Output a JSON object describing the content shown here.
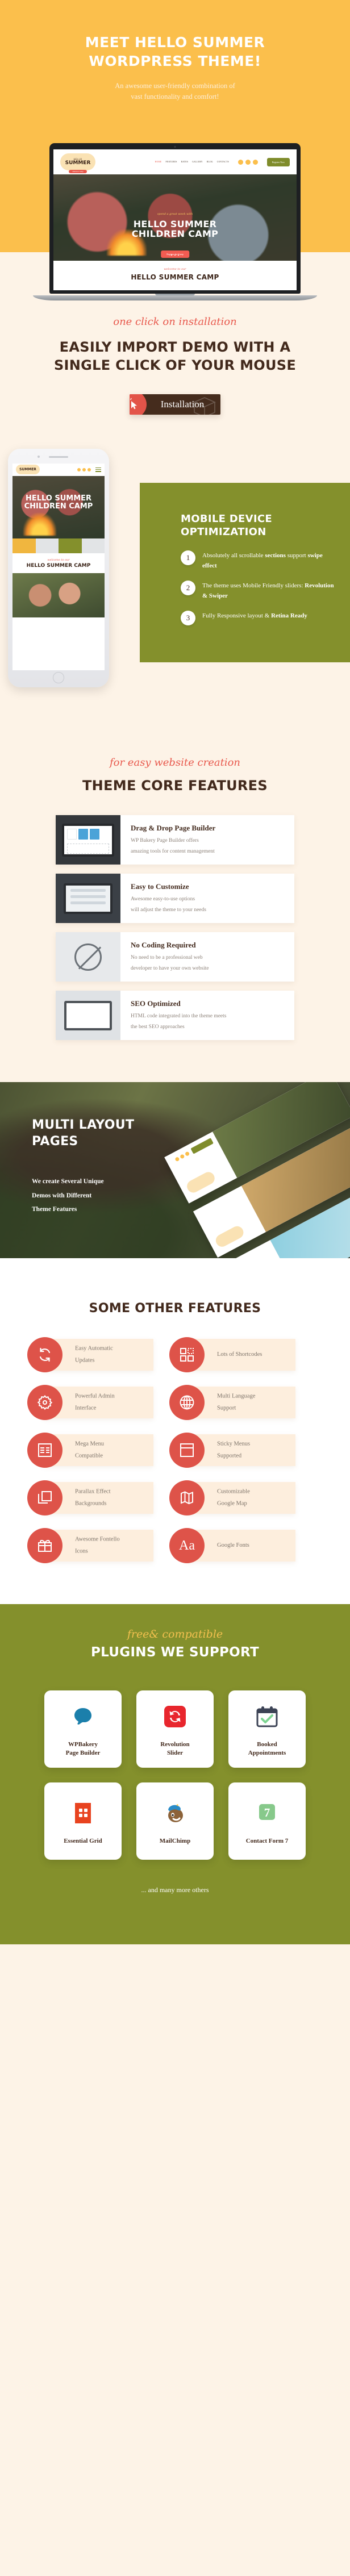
{
  "hero": {
    "title_line1": "Meet Hello Summer",
    "title_line2": "WordPress Theme!",
    "subtitle_line1": "An awesome user-friendly combination of",
    "subtitle_line2": "vast functionality and comfort!",
    "bg_color": "#fbbf4c",
    "laptop_preview": {
      "logo_top": "HELLO",
      "logo_main": "SUMMER",
      "logo_badge": "children camp",
      "nav": [
        "HOME",
        "FEATURES",
        "RATES",
        "GALLERY",
        "BLOG",
        "CONTACTS"
      ],
      "cta": "Register Now",
      "slide_script": "spend a great week with",
      "slide_title_1": "HELLO SUMMER",
      "slide_title_2": "CHILDREN CAMP",
      "slide_button": "Register for Camp",
      "welcome_script": "welcome to our",
      "welcome_title": "HELLO SUMMER CAMP"
    }
  },
  "installation": {
    "script": "one click on installation",
    "heading_line1": "Easily Import Demo With a",
    "heading_line2": "Single Click of Your Mouse",
    "button_label": "Installation",
    "button_bg": "#452c1d",
    "button_circle_color": "#e35449",
    "cursor_icon": "cursor-click-icon"
  },
  "mobile": {
    "heading_line1": "Mobile Device",
    "heading_line2": "Optimization",
    "panel_color": "#84902c",
    "items": [
      {
        "number": "1",
        "text_normal": "Absolutely all scrollable ",
        "text_bold_1": "sections",
        "text_mid": " support ",
        "text_bold_2": "swipe effect"
      },
      {
        "number": "2",
        "text_normal": "The theme uses Mobile Friendly sliders: ",
        "text_bold_1": "Revolution & Swiper",
        "text_mid": "",
        "text_bold_2": ""
      },
      {
        "number": "3",
        "text_normal": "Fully Responsive layout & ",
        "text_bold_1": "Retina Ready",
        "text_mid": "",
        "text_bold_2": ""
      }
    ],
    "phone_preview": {
      "logo": "SUMMER",
      "title_1": "HELLO SUMMER",
      "title_2": "CHILDREN CAMP",
      "welcome_script": "welcome to our",
      "welcome_title": "HELLO SUMMER CAMP"
    }
  },
  "core_features": {
    "script": "for easy website creation",
    "heading": "Theme Core Features",
    "cards": [
      {
        "thumb": "drag-drop-builder-thumb",
        "title": "Drag & Drop Page Builder",
        "desc_line1": "WP Bakery Page Builder offers",
        "desc_line2": "amazing tools for content management"
      },
      {
        "thumb": "customize-thumb",
        "title": "Easy to Customize",
        "desc_line1": "Awesome easy-to-use options",
        "desc_line2": "will adjust the theme to your needs"
      },
      {
        "thumb": "no-coding-thumb",
        "title": "No Coding Required",
        "desc_line1": "No need to be a professional web",
        "desc_line2": "developer to have your own website"
      },
      {
        "thumb": "seo-thumb",
        "title": "SEO Optimized",
        "desc_line1": "HTML code integrated into the theme meets",
        "desc_line2": "the best SEO approaches"
      }
    ]
  },
  "multi_layout": {
    "heading_line1": "Multi Layout",
    "heading_line2": "Pages",
    "desc_line1": "We create Several Unique",
    "desc_line2": "Demos with Different",
    "desc_line3": "Theme Features"
  },
  "other_features": {
    "heading": "Some Other Features",
    "accent_color": "#de5349",
    "card_bg": "#fdeedd",
    "items": [
      {
        "icon": "refresh-icon",
        "label_line1": "Easy Automatic",
        "label_line2": "Updates"
      },
      {
        "icon": "shortcodes-grid-icon",
        "label_line1": "Lots of Shortcodes",
        "label_line2": ""
      },
      {
        "icon": "gear-icon",
        "label_line1": "Powerful Admin",
        "label_line2": "Interface"
      },
      {
        "icon": "globe-icon",
        "label_line1": "Multi Language",
        "label_line2": "Support"
      },
      {
        "icon": "mega-menu-icon",
        "label_line1": "Mega Menu",
        "label_line2": "Compatible"
      },
      {
        "icon": "sticky-menu-icon",
        "label_line1": "Sticky Menus",
        "label_line2": "Supported"
      },
      {
        "icon": "layers-icon",
        "label_line1": "Parallax Effect",
        "label_line2": "Backgrounds"
      },
      {
        "icon": "map-icon",
        "label_line1": "Customizable",
        "label_line2": "Google Map"
      },
      {
        "icon": "gift-icon",
        "label_line1": "Awesome Fontello",
        "label_line2": "Icons"
      },
      {
        "icon": "typography-aa-icon",
        "label_line1": "Google Fonts",
        "label_line2": ""
      }
    ],
    "aa_glyph": "Aa"
  },
  "plugins": {
    "script": "free& compatible",
    "heading": "Plugins We Support",
    "bg_color": "#84902c",
    "cards": [
      {
        "icon": "wpbakery-icon",
        "name_line1": "WPBakery",
        "name_line2": "Page Builder"
      },
      {
        "icon": "revolution-slider-icon",
        "name_line1": "Revolution",
        "name_line2": "Slider"
      },
      {
        "icon": "booked-calendar-icon",
        "name_line1": "Booked",
        "name_line2": "Appointments"
      },
      {
        "icon": "essential-grid-icon",
        "name_line1": "Essential Grid",
        "name_line2": ""
      },
      {
        "icon": "mailchimp-icon",
        "name_line1": "MailChimp",
        "name_line2": ""
      },
      {
        "icon": "contact-form-7-icon",
        "name_line1": "Contact Form 7",
        "name_line2": "",
        "badge": "7"
      }
    ],
    "footer_note": "... and many more others"
  }
}
